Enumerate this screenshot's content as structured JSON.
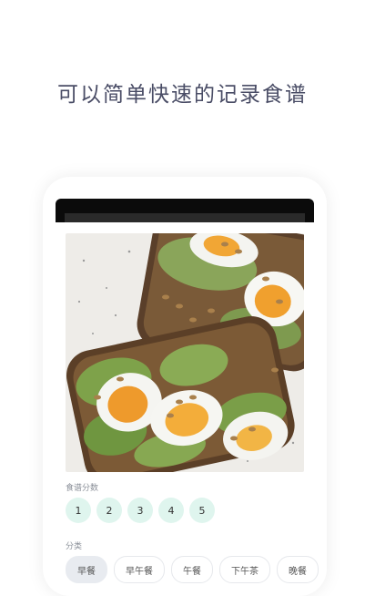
{
  "headline": "可以简单快速的记录食谱",
  "score_section": {
    "label": "食谱分数",
    "options": [
      "1",
      "2",
      "3",
      "4",
      "5"
    ]
  },
  "category_section": {
    "label": "分类",
    "options": [
      "早餐",
      "早午餐",
      "午餐",
      "下午茶",
      "晚餐"
    ],
    "selected": "早餐"
  },
  "photo": {
    "subject": "avocado-egg-toast"
  },
  "colors": {
    "headline": "#4a4d66",
    "chip_bg": "#dff5ee",
    "selected_chip_bg": "#e8ebf0"
  }
}
